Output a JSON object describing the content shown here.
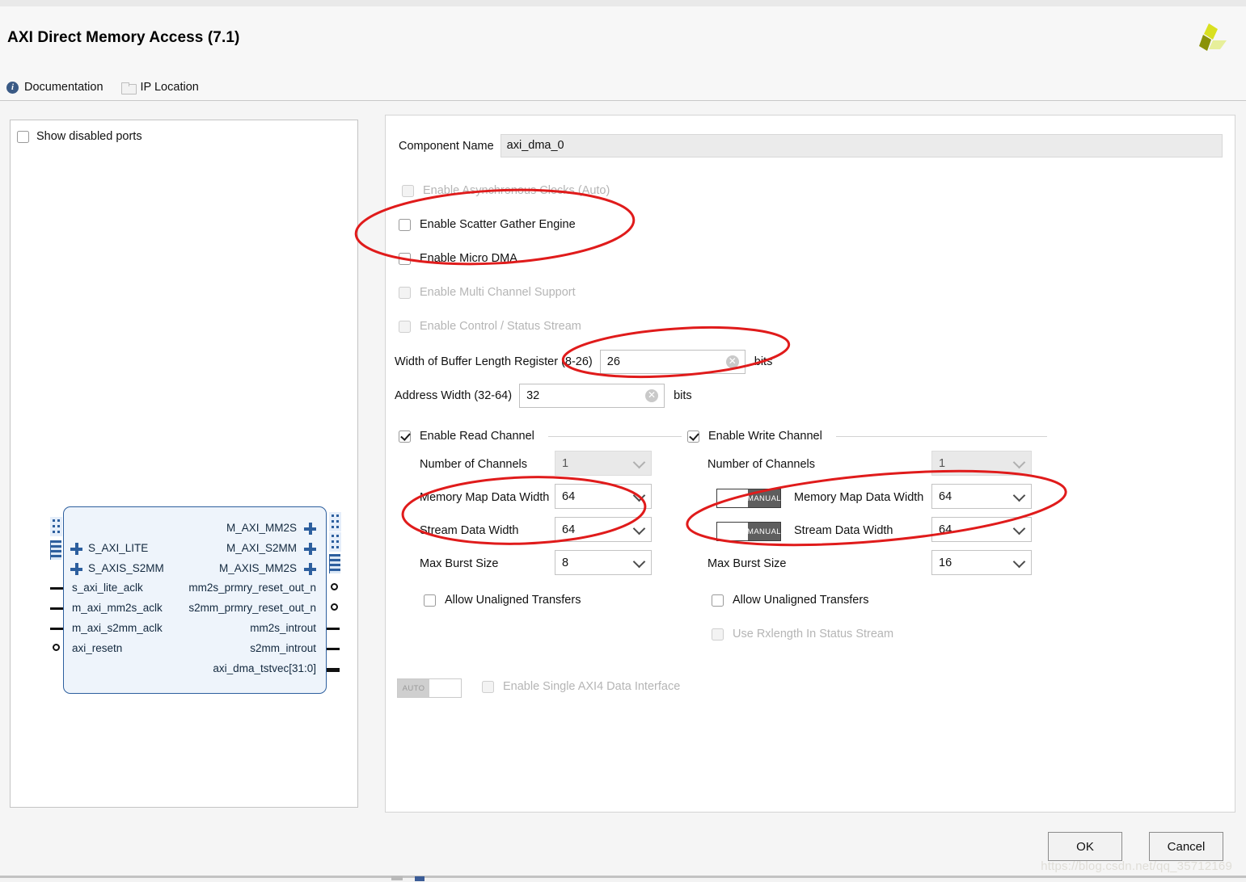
{
  "window": {
    "title": "AXI Direct Memory Access (7.1)",
    "logo_name": "xilinx-logo"
  },
  "links": [
    {
      "label": "Documentation",
      "icon": "info-icon"
    },
    {
      "label": "IP Location",
      "icon": "folder-icon"
    }
  ],
  "left_panel": {
    "show_disabled_ports": {
      "label": "Show disabled ports",
      "checked": false
    },
    "diagram": {
      "left_bus_ports": [
        "S_AXI_LITE",
        "S_AXIS_S2MM"
      ],
      "left_signal_ports": [
        "s_axi_lite_aclk",
        "m_axi_mm2s_aclk",
        "m_axi_s2mm_aclk",
        "axi_resetn"
      ],
      "right_bus_ports": [
        "M_AXI_MM2S",
        "M_AXI_S2MM",
        "M_AXIS_MM2S"
      ],
      "right_signal_ports": [
        "mm2s_prmry_reset_out_n",
        "s2mm_prmry_reset_out_n",
        "mm2s_introut",
        "s2mm_introut",
        "axi_dma_tstvec[31:0]"
      ]
    }
  },
  "form": {
    "component_name": {
      "label": "Component Name",
      "value": "axi_dma_0"
    },
    "checkboxes": [
      {
        "label": "Enable Asynchronous Clocks (Auto)",
        "checked": false,
        "disabled": true
      },
      {
        "label": "Enable Scatter Gather Engine",
        "checked": false,
        "disabled": false
      },
      {
        "label": "Enable Micro DMA",
        "checked": false,
        "disabled": false
      },
      {
        "label": "Enable Multi Channel Support",
        "checked": false,
        "disabled": true
      },
      {
        "label": "Enable Control / Status Stream",
        "checked": false,
        "disabled": true
      }
    ],
    "buffer_length": {
      "label": "Width of Buffer Length Register (8-26)",
      "value": "26",
      "units": "bits"
    },
    "address_width": {
      "label": "Address Width (32-64)",
      "value": "32",
      "units": "bits"
    },
    "read_channel": {
      "group_label": "Enable Read Channel",
      "checked": true,
      "rows": [
        {
          "label": "Number of Channels",
          "value": "1",
          "disabled": true,
          "toggle": null
        },
        {
          "label": "Memory Map Data Width",
          "value": "64",
          "disabled": false,
          "toggle": null
        },
        {
          "label": "Stream Data Width",
          "value": "64",
          "disabled": false,
          "toggle": null
        },
        {
          "label": "Max Burst Size",
          "value": "8",
          "disabled": false,
          "toggle": null
        }
      ],
      "allow_unaligned": {
        "label": "Allow Unaligned Transfers",
        "checked": false,
        "disabled": false
      }
    },
    "write_channel": {
      "group_label": "Enable Write Channel",
      "checked": true,
      "rows": [
        {
          "label": "Number of Channels",
          "value": "1",
          "disabled": true,
          "toggle": null
        },
        {
          "label": "Memory Map Data Width",
          "value": "64",
          "disabled": false,
          "toggle": "MANUAL"
        },
        {
          "label": "Stream Data Width",
          "value": "64",
          "disabled": false,
          "toggle": "MANUAL"
        },
        {
          "label": "Max Burst Size",
          "value": "16",
          "disabled": false,
          "toggle": null
        }
      ],
      "allow_unaligned": {
        "label": "Allow Unaligned Transfers",
        "checked": false,
        "disabled": false
      },
      "use_rxlength": {
        "label": "Use Rxlength In Status Stream",
        "checked": false,
        "disabled": true
      }
    },
    "single_axi4": {
      "toggle_label": "AUTO",
      "label": "Enable Single AXI4 Data Interface",
      "checked": false,
      "disabled": true
    }
  },
  "footer": {
    "ok_label": "OK",
    "cancel_label": "Cancel",
    "watermark": "https://blog.csdn.net/qq_35712169"
  },
  "annotations": {
    "color": "#e01b1b",
    "items": [
      {
        "name": "annotation-ellipse-sg-micro-dma"
      },
      {
        "name": "annotation-ellipse-buffer-length"
      },
      {
        "name": "annotation-ellipse-read-widths"
      },
      {
        "name": "annotation-ellipse-write-widths"
      }
    ]
  }
}
